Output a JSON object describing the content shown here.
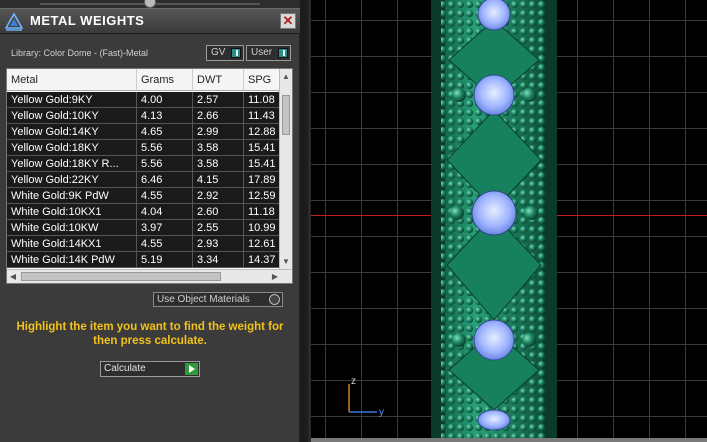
{
  "window": {
    "title": "METAL WEIGHTS",
    "close_glyph": "✕",
    "title_icon": "metal-weights-logo-icon"
  },
  "library": {
    "label": "Library: Color Dome - (Fast)-Metal",
    "toggles": [
      {
        "label": "GV"
      },
      {
        "label": "User"
      }
    ]
  },
  "table": {
    "columns": [
      "Metal",
      "Grams",
      "DWT",
      "SPG"
    ],
    "rows": [
      [
        "Yellow Gold:9KY",
        "4.00",
        "2.57",
        "11.08"
      ],
      [
        "Yellow Gold:10KY",
        "4.13",
        "2.66",
        "11.43"
      ],
      [
        "Yellow Gold:14KY",
        "4.65",
        "2.99",
        "12.88"
      ],
      [
        "Yellow Gold:18KY",
        "5.56",
        "3.58",
        "15.41"
      ],
      [
        "Yellow Gold:18KY R...",
        "5.56",
        "3.58",
        "15.41"
      ],
      [
        "Yellow Gold:22KY",
        "6.46",
        "4.15",
        "17.89"
      ],
      [
        "White Gold:9K PdW",
        "4.55",
        "2.92",
        "12.59"
      ],
      [
        "White Gold:10KX1",
        "4.04",
        "2.60",
        "11.18"
      ],
      [
        "White Gold:10KW",
        "3.97",
        "2.55",
        "10.99"
      ],
      [
        "White Gold:14KX1",
        "4.55",
        "2.93",
        "12.61"
      ],
      [
        "White Gold:14K PdW",
        "5.19",
        "3.34",
        "14.37"
      ]
    ]
  },
  "use_object_materials": "Use Object Materials",
  "hint": "Highlight the item you want to find the weight for then press calculate.",
  "calculate_button": "Calculate",
  "viewport": {
    "axis_labels": {
      "z": "z",
      "y": "y"
    },
    "colors": {
      "metal": "#1f8a66",
      "gem": "#9db3ff",
      "grid": "#3a3a3a",
      "axis_red": "#c02020",
      "highlight_text": "#f2c21b"
    }
  }
}
